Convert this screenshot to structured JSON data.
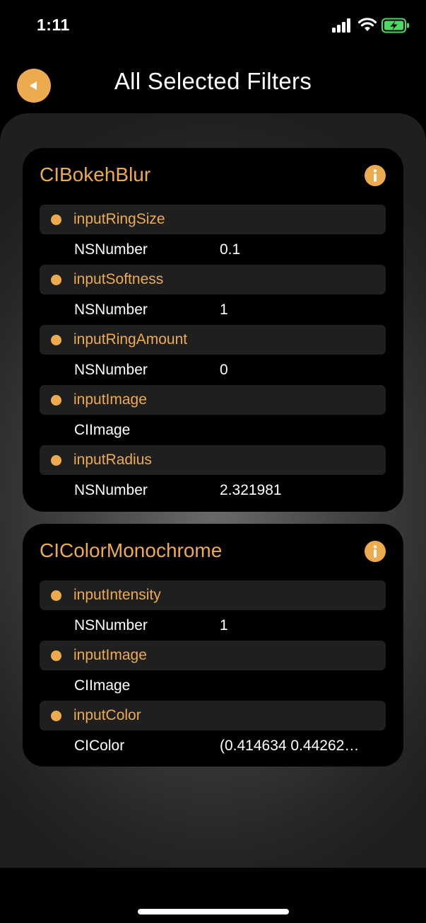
{
  "status_bar": {
    "time": "1:11",
    "icons": [
      "cellular-signal-icon",
      "wifi-icon",
      "battery-charging-icon"
    ]
  },
  "header": {
    "back_icon": "back-arrow-icon",
    "title": "All Selected Filters"
  },
  "colors": {
    "accent": "#EDAB4F",
    "card_background": "#000000",
    "param_header_background": "#1F1F1F",
    "text": "#FFFFFF"
  },
  "filters": [
    {
      "name": "CIBokehBlur",
      "info_icon": "info-icon",
      "params": [
        {
          "name": "inputRingSize",
          "type": "NSNumber",
          "value": "0.1"
        },
        {
          "name": "inputSoftness",
          "type": "NSNumber",
          "value": "1"
        },
        {
          "name": "inputRingAmount",
          "type": "NSNumber",
          "value": "0"
        },
        {
          "name": "inputImage",
          "type": "CIImage",
          "value": ""
        },
        {
          "name": "inputRadius",
          "type": "NSNumber",
          "value": "2.321981"
        }
      ]
    },
    {
      "name": "CIColorMonochrome",
      "info_icon": "info-icon",
      "params": [
        {
          "name": "inputIntensity",
          "type": "NSNumber",
          "value": "1"
        },
        {
          "name": "inputImage",
          "type": "CIImage",
          "value": ""
        },
        {
          "name": "inputColor",
          "type": "CIColor",
          "value": "(0.414634 0.44262…"
        }
      ]
    }
  ]
}
